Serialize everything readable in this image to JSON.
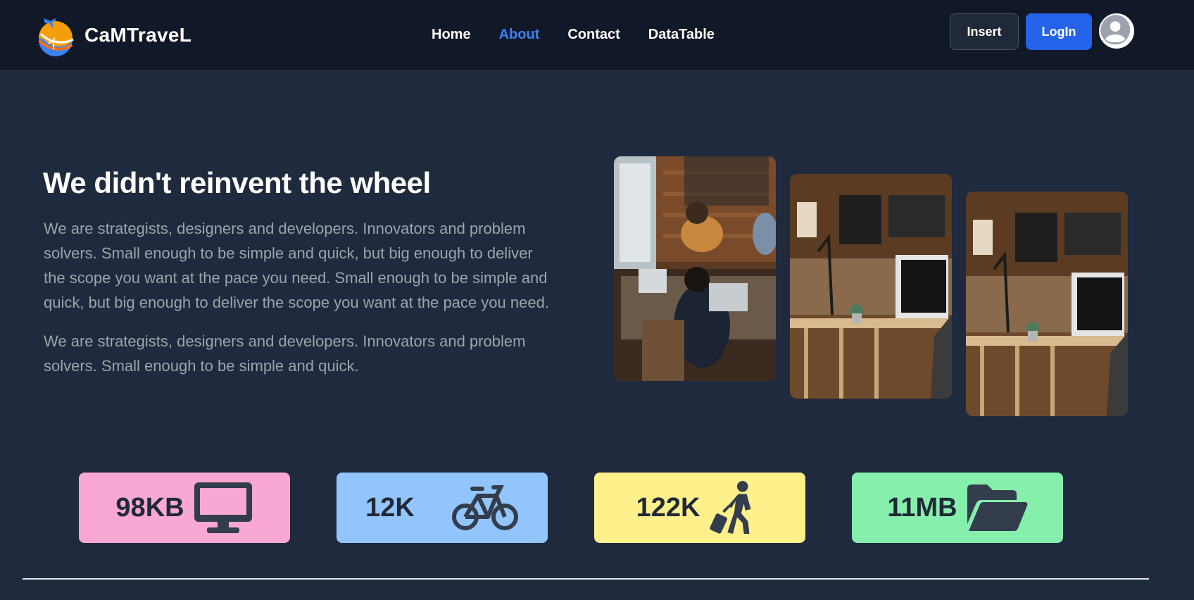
{
  "brand": {
    "name": "CaMTraveL"
  },
  "nav": {
    "links": [
      {
        "label": "Home",
        "active": false
      },
      {
        "label": "About",
        "active": true
      },
      {
        "label": "Contact",
        "active": false
      },
      {
        "label": "DataTable",
        "active": false
      }
    ],
    "insert_label": "Insert",
    "login_label": "LogIn"
  },
  "hero": {
    "title": "We didn't reinvent the wheel",
    "paragraph1": "We are strategists, designers and developers. Innovators and problem solvers. Small enough to be simple and quick, but big enough to deliver the scope you want at the pace you need. Small enough to be simple and quick, but big enough to deliver the scope you want at the pace you need.",
    "paragraph2": "We are strategists, designers and developers. Innovators and problem solvers. Small enough to be simple and quick."
  },
  "stats": [
    {
      "value": "98KB",
      "icon": "desktop-icon",
      "color": "#f9a8d4"
    },
    {
      "value": "12K",
      "icon": "bicycle-icon",
      "color": "#93c5fd"
    },
    {
      "value": "122K",
      "icon": "traveler-luggage-icon",
      "color": "#fef08a"
    },
    {
      "value": "11MB",
      "icon": "folder-open-icon",
      "color": "#86efac"
    }
  ],
  "colors": {
    "background": "#1f2a3e",
    "navbar": "#111827",
    "accent": "#2563eb",
    "active_link": "#3b82f6",
    "muted_text": "#9ca3af"
  }
}
